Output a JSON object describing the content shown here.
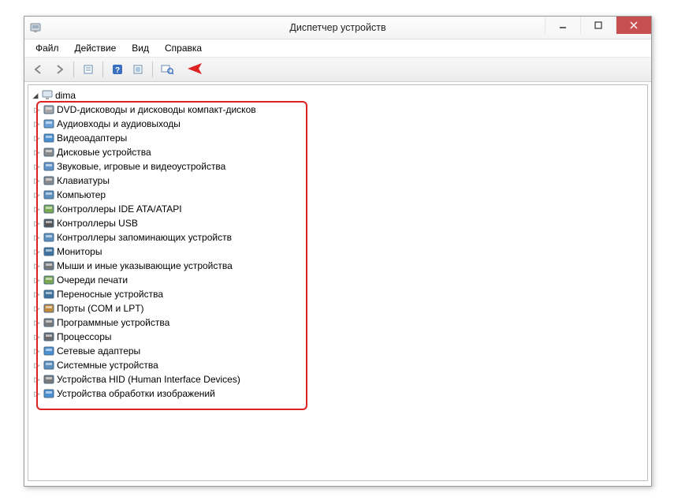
{
  "window": {
    "title": "Диспетчер устройств"
  },
  "menu": {
    "file": "Файл",
    "action": "Действие",
    "view": "Вид",
    "help": "Справка"
  },
  "toolbar": {
    "buttons": {
      "back": "back",
      "forward": "forward",
      "properties": "properties",
      "help": "help",
      "scan": "scan",
      "show": "show-hidden"
    }
  },
  "tree": {
    "root": "dima",
    "items": [
      "DVD-дисководы и дисководы компакт-дисков",
      "Аудиовходы и аудиовыходы",
      "Видеоадаптеры",
      "Дисковые устройства",
      "Звуковые, игровые и видеоустройства",
      "Клавиатуры",
      "Компьютер",
      "Контроллеры IDE ATA/ATAPI",
      "Контроллеры USB",
      "Контроллеры запоминающих устройств",
      "Мониторы",
      "Мыши и иные указывающие устройства",
      "Очереди печати",
      "Переносные устройства",
      "Порты (COM и LPT)",
      "Программные устройства",
      "Процессоры",
      "Сетевые адаптеры",
      "Системные устройства",
      "Устройства HID (Human Interface Devices)",
      "Устройства обработки изображений"
    ]
  },
  "icons": {
    "categories": [
      "disc",
      "audio",
      "display",
      "disk",
      "sound",
      "keyboard",
      "computer",
      "ide",
      "usb",
      "storage",
      "monitor",
      "mouse",
      "printer",
      "portable",
      "port",
      "software",
      "cpu",
      "network",
      "system",
      "hid",
      "imaging"
    ],
    "colors": {
      "disc": "#a7a7a7",
      "audio": "#6aa0d8",
      "display": "#4a8fd0",
      "disk": "#8a8a8a",
      "sound": "#5f93c9",
      "keyboard": "#888",
      "computer": "#5a8fc0",
      "ide": "#7aa84f",
      "usb": "#555",
      "storage": "#5a8fc0",
      "monitor": "#3e729e",
      "mouse": "#777",
      "printer": "#7aa84f",
      "portable": "#3e729e",
      "port": "#c08a3a",
      "software": "#7a7a7a",
      "cpu": "#6a6a6a",
      "network": "#4a8fd0",
      "system": "#5a8fc0",
      "hid": "#7a7a7a",
      "imaging": "#4a8fd0"
    }
  }
}
